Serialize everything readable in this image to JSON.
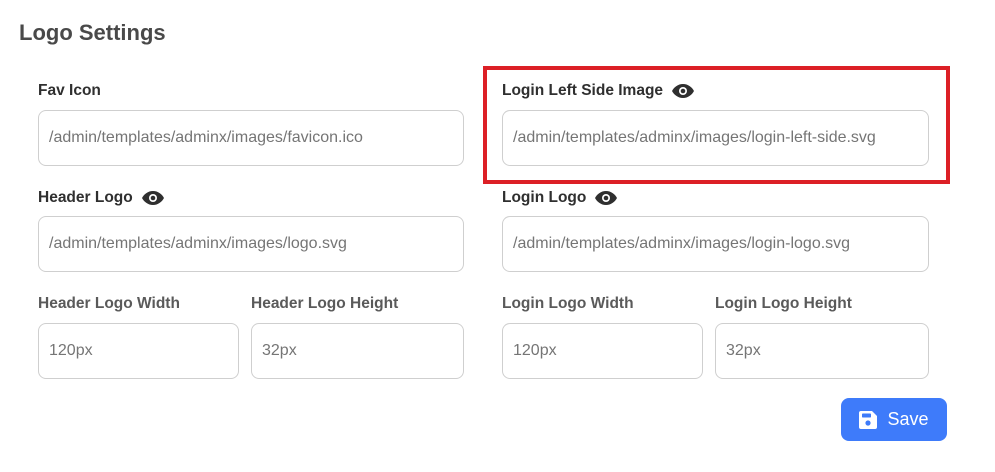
{
  "page": {
    "title": "Logo Settings"
  },
  "fields": {
    "fav_icon": {
      "label": "Fav Icon",
      "placeholder": "/admin/templates/adminx/images/favicon.ico"
    },
    "login_left_side_image": {
      "label": "Login Left Side Image",
      "placeholder": "/admin/templates/adminx/images/login-left-side.svg"
    },
    "header_logo": {
      "label": "Header Logo",
      "placeholder": "/admin/templates/adminx/images/logo.svg"
    },
    "login_logo": {
      "label": "Login Logo",
      "placeholder": "/admin/templates/adminx/images/login-logo.svg"
    },
    "header_logo_width": {
      "label": "Header Logo Width",
      "placeholder": "120px"
    },
    "header_logo_height": {
      "label": "Header Logo Height",
      "placeholder": "32px"
    },
    "login_logo_width": {
      "label": "Login Logo Width",
      "placeholder": "120px"
    },
    "login_logo_height": {
      "label": "Login Logo Height",
      "placeholder": "32px"
    }
  },
  "actions": {
    "save_label": "Save"
  },
  "icons": {
    "preview": "eye-icon",
    "save": "floppy-disk-icon"
  },
  "colors": {
    "accent": "#3e7bfa",
    "highlight": "#dc1f26"
  }
}
